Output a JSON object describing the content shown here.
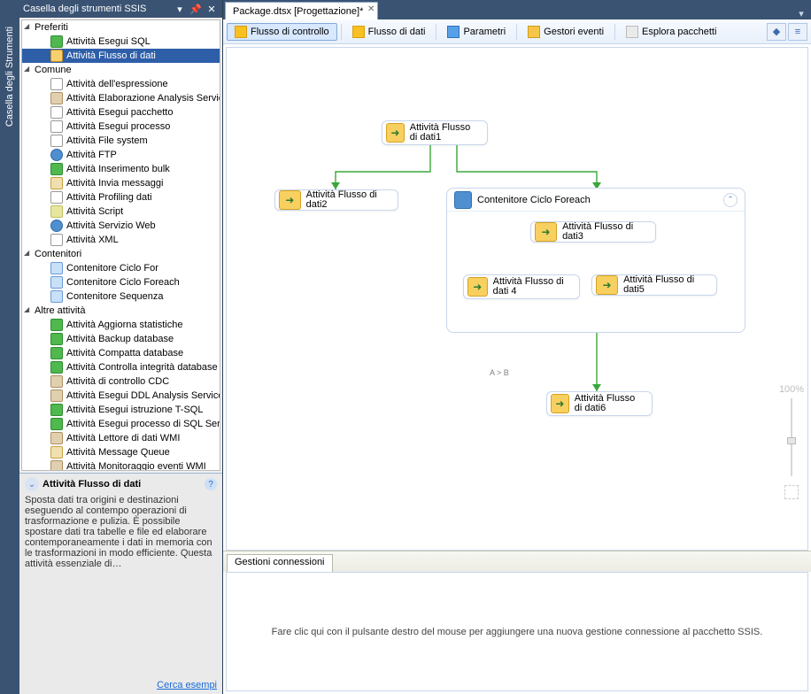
{
  "side_tab": "Casella degli Strumenti",
  "toolbox_title": "Casella degli strumenti SSIS",
  "toolbox": {
    "cats": [
      {
        "name": "Preferiti",
        "items": [
          {
            "label": "Attività Esegui SQL",
            "ic": "db"
          },
          {
            "label": "Attività Flusso di dati",
            "ic": "",
            "selected": true
          }
        ]
      },
      {
        "name": "Comune",
        "items": [
          {
            "label": "Attività dell'espressione",
            "ic": "fx"
          },
          {
            "label": "Attività Elaborazione Analysis Services",
            "ic": "other"
          },
          {
            "label": "Attività Esegui pacchetto",
            "ic": "file"
          },
          {
            "label": "Attività Esegui processo",
            "ic": "file"
          },
          {
            "label": "Attività File system",
            "ic": "file"
          },
          {
            "label": "Attività FTP",
            "ic": "world"
          },
          {
            "label": "Attività Inserimento bulk",
            "ic": "db"
          },
          {
            "label": "Attività Invia messaggi",
            "ic": "mail"
          },
          {
            "label": "Attività Profiling dati",
            "ic": "file"
          },
          {
            "label": "Attività Script",
            "ic": "script"
          },
          {
            "label": "Attività Servizio Web",
            "ic": "world"
          },
          {
            "label": "Attività XML",
            "ic": "file"
          }
        ]
      },
      {
        "name": "Contenitori",
        "items": [
          {
            "label": "Contenitore Ciclo For",
            "ic": "cont"
          },
          {
            "label": "Contenitore Ciclo Foreach",
            "ic": "cont"
          },
          {
            "label": "Contenitore Sequenza",
            "ic": "cont"
          }
        ]
      },
      {
        "name": "Altre attività",
        "items": [
          {
            "label": "Attività Aggiorna statistiche",
            "ic": "db"
          },
          {
            "label": "Attività Backup database",
            "ic": "db"
          },
          {
            "label": "Attività Compatta database",
            "ic": "db"
          },
          {
            "label": "Attività Controlla integrità database",
            "ic": "db"
          },
          {
            "label": "Attività di controllo CDC",
            "ic": "other"
          },
          {
            "label": "Attività Esegui DDL Analysis Services",
            "ic": "other"
          },
          {
            "label": "Attività Esegui istruzione T-SQL",
            "ic": "db"
          },
          {
            "label": "Attività Esegui processo di SQL Serv…",
            "ic": "db"
          },
          {
            "label": "Attività Lettore di dati WMI",
            "ic": "other"
          },
          {
            "label": "Attività Message Queue",
            "ic": "mail"
          },
          {
            "label": "Attività Monitoraggio eventi WMI",
            "ic": "other"
          }
        ]
      }
    ]
  },
  "help": {
    "title": "Attività Flusso di dati",
    "body": "Sposta dati tra origini e destinazioni eseguendo al contempo operazioni di trasformazione e pulizia. È possibile spostare dati tra tabelle e file ed elaborare contemporaneamente i dati in memoria con le trasformazioni in modo efficiente. Questa attività essenziale di…",
    "link": "Cerca esempi"
  },
  "doc_tab": "Package.dtsx [Progettazione]*",
  "design_tabs": {
    "t1": "Flusso di controllo",
    "t2": "Flusso di dati",
    "t3": "Parametri",
    "t4": "Gestori eventi",
    "t5": "Esplora pacchetti"
  },
  "nodes": {
    "n1": "Attività Flusso di dati1",
    "n2": "Attività Flusso di dati2",
    "n3": "Attività Flusso di dati3",
    "n4": "Attività Flusso di dati 4",
    "n5": "Attività Flusso di dati5",
    "n6": "Attività Flusso di dati6",
    "container": "Contenitore Ciclo Foreach",
    "constraint": "A > B"
  },
  "zoom_label": "100%",
  "conn": {
    "tab": "Gestioni connessioni",
    "hint": "Fare clic qui con il pulsante destro del mouse per aggiungere una nuova gestione connessione al pacchetto SSIS."
  }
}
